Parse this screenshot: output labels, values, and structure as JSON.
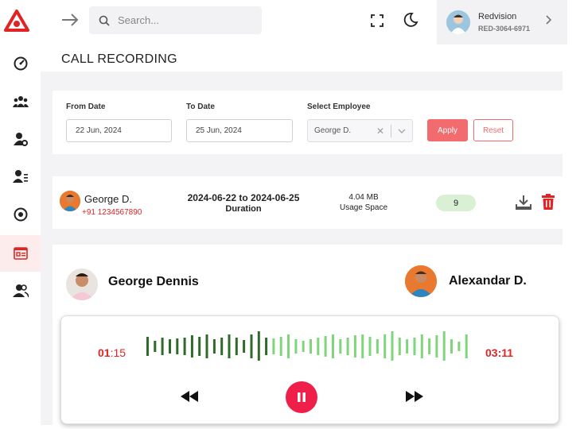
{
  "topbar": {
    "search_placeholder": "Search...",
    "user": {
      "name": "Redvision",
      "id": "RED-3064-6971"
    }
  },
  "page": {
    "title": "CALL RECORDING"
  },
  "filters": {
    "from_label": "From Date",
    "from_value": "22 Jun, 2024",
    "to_label": "To Date",
    "to_value": "25 Jun, 2024",
    "employee_label": "Select Employee",
    "employee_value": "George D.",
    "apply_label": "Apply",
    "reset_label": "Reset"
  },
  "record": {
    "name": "George D.",
    "phone": "+91 1234567890",
    "range": "2024-06-22 to 2024-06-25",
    "duration_label": "Duration",
    "size": "4.04 MB",
    "usage_label": "Usage Space",
    "count": "9"
  },
  "player": {
    "caller": "George Dennis",
    "receiver": "Alexandar D.",
    "elapsed_min": "01",
    "elapsed_sec": ":15",
    "total": "03:11",
    "progress": 0.39
  },
  "colors": {
    "accent": "#ee1f48",
    "played_wave": "#2e6b2a",
    "unplayed_wave": "#7fd67a"
  }
}
